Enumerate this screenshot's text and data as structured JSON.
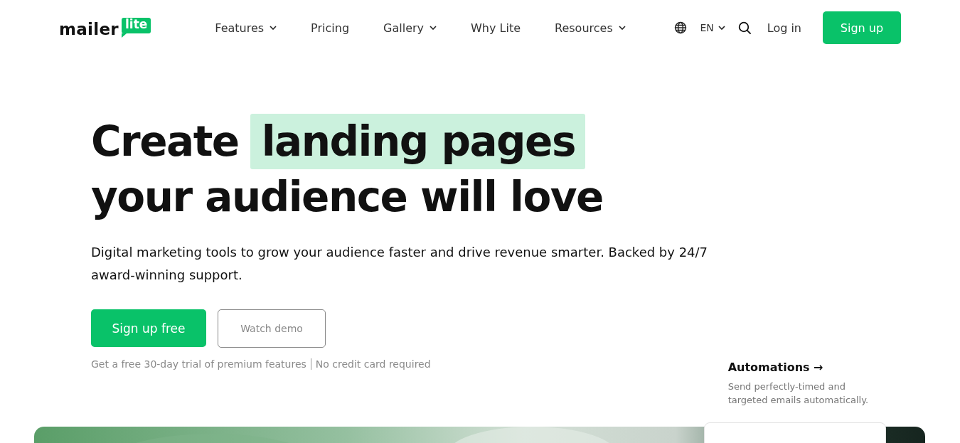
{
  "header": {
    "logo": {
      "word": "mailer",
      "badge": "lite"
    },
    "nav": [
      {
        "label": "Features",
        "dropdown": true
      },
      {
        "label": "Pricing",
        "dropdown": false
      },
      {
        "label": "Gallery",
        "dropdown": true
      },
      {
        "label": "Why Lite",
        "dropdown": false
      },
      {
        "label": "Resources",
        "dropdown": true
      }
    ],
    "language": "EN",
    "login": "Log in",
    "signup": "Sign up"
  },
  "hero": {
    "title_before": "Create",
    "title_highlight": "landing pages",
    "title_after": "your audience will love",
    "subtitle": "Digital marketing tools to grow your audience faster and drive revenue smarter. Backed by 24/7 award-winning support.",
    "primary_button": "Sign up free",
    "secondary_button": "Watch demo",
    "note_left": "Get a free 30-day trial of premium features",
    "note_right": "No credit card required"
  },
  "feature": {
    "title": "Automations →",
    "description": "Send perfectly-timed and targeted emails automatically."
  }
}
